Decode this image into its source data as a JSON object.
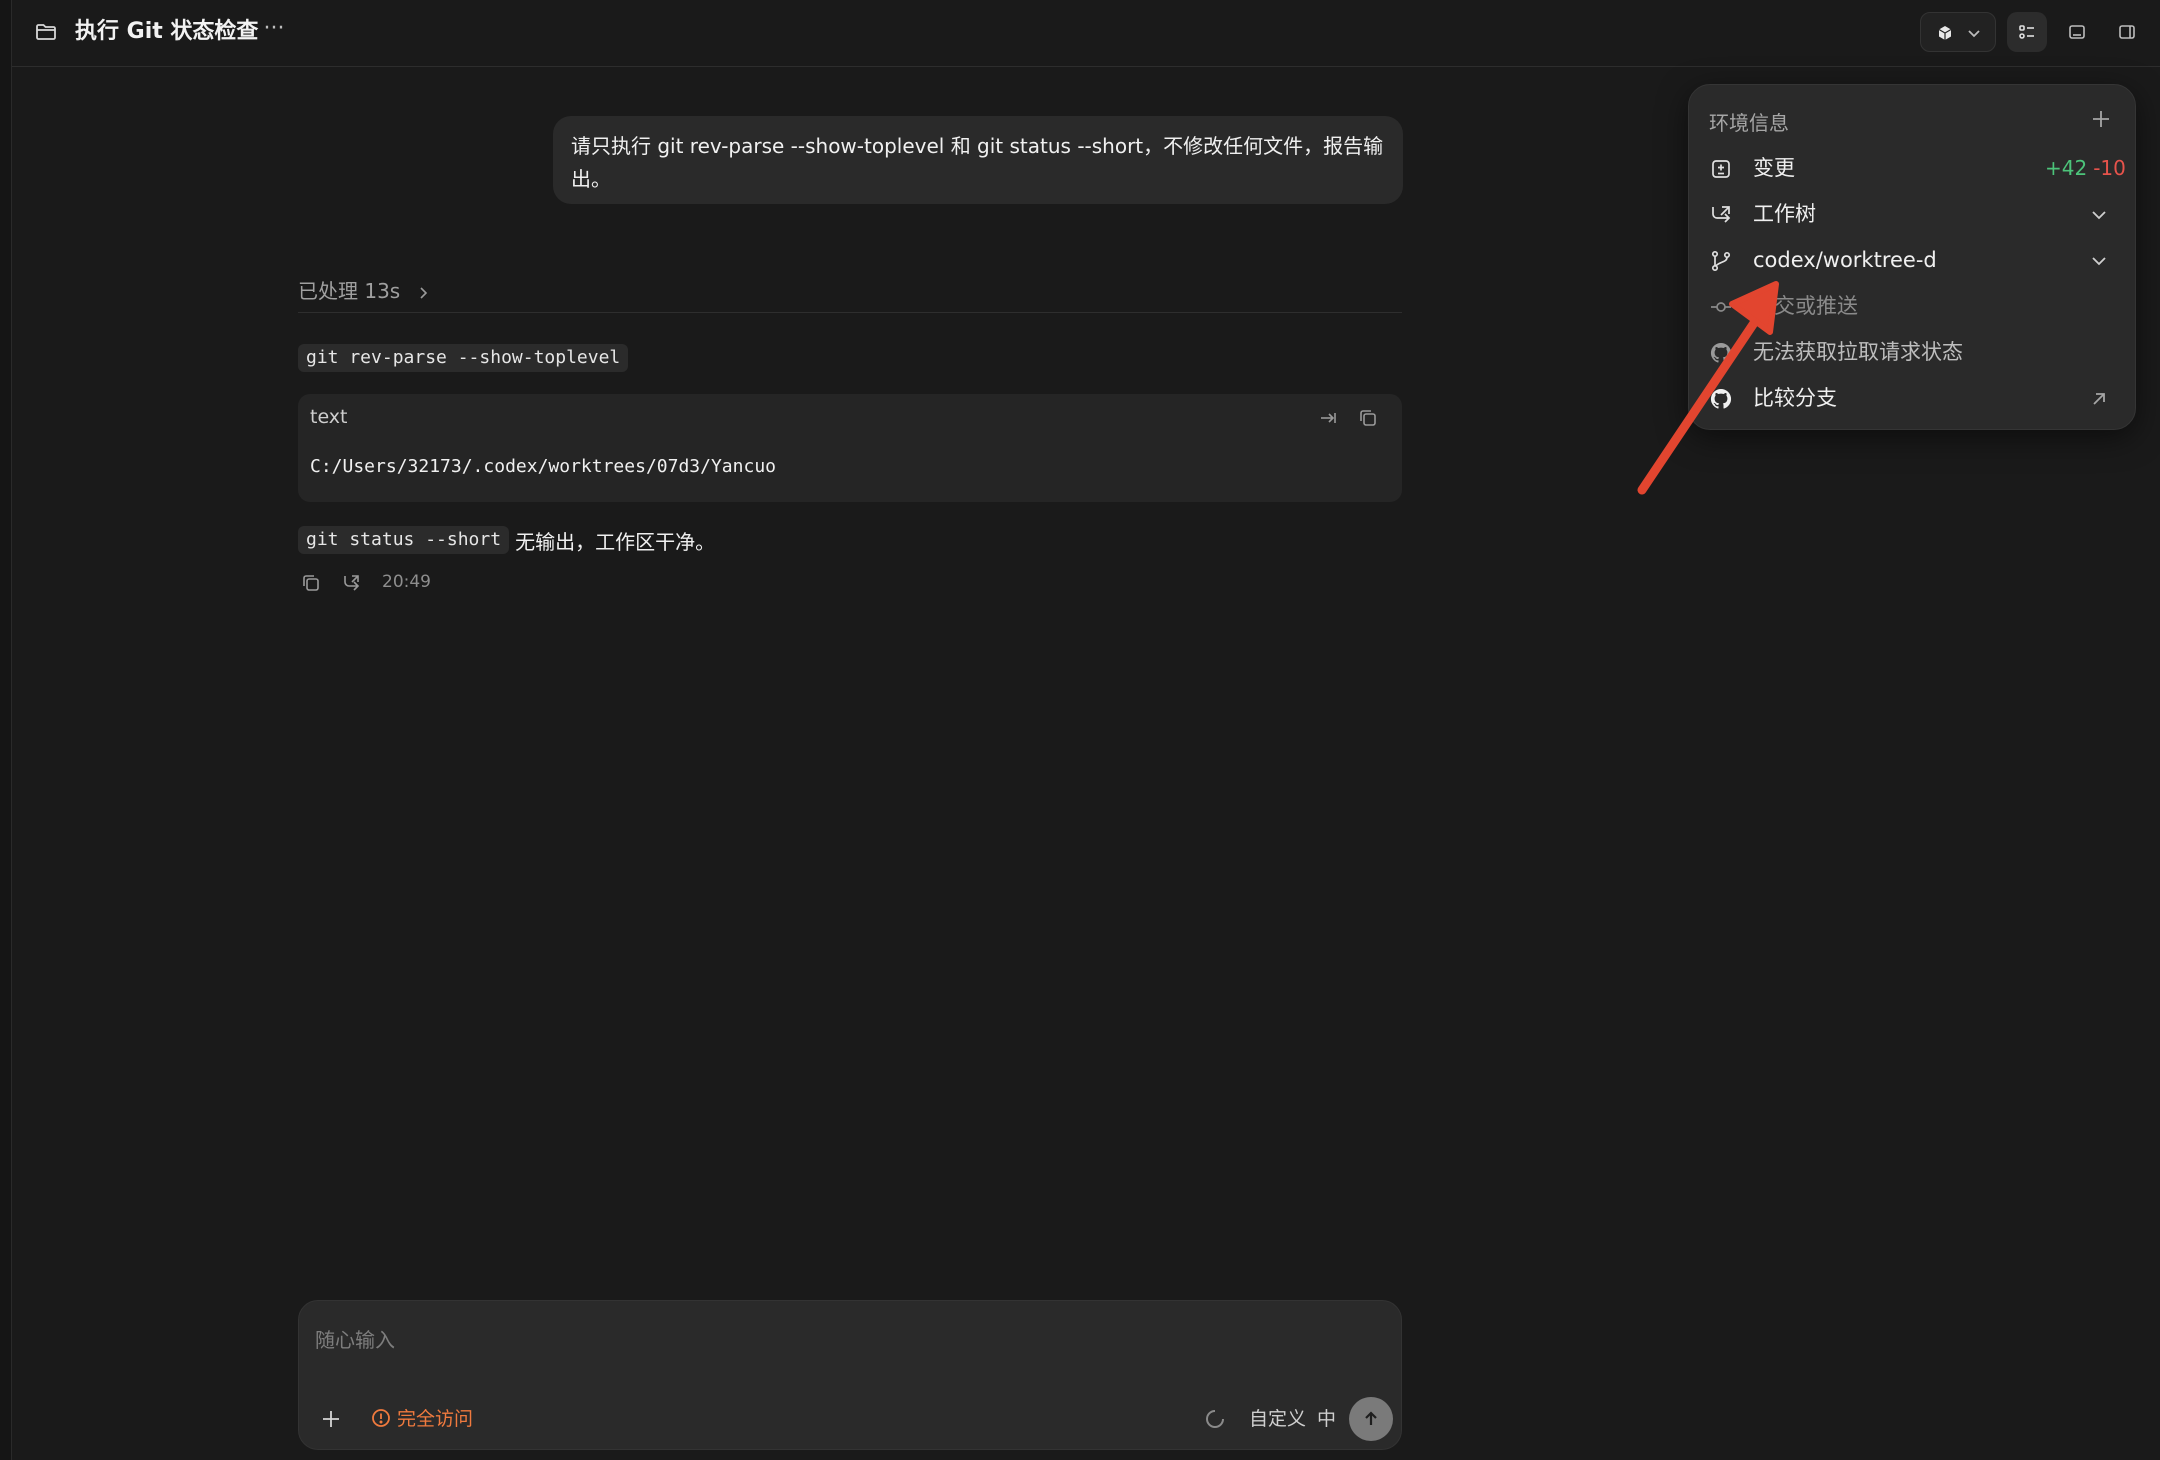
{
  "header": {
    "title": "执行 Git 状态检查",
    "more_label": "···"
  },
  "conversation": {
    "user_message": "请只执行 git rev-parse --show-toplevel 和 git status --short，不修改任何文件，报告输出。",
    "processed_label": "已处理 13s",
    "command_1": "git rev-parse --show-toplevel",
    "code_block": {
      "language": "text",
      "output": "C:/Users/32173/.codex/worktrees/07d3/Yancuo"
    },
    "command_2": "git status --short",
    "result_text": "无输出，工作区干净。",
    "time": "20:49"
  },
  "composer": {
    "placeholder": "随心输入",
    "access_label": "完全访问",
    "mode_label": "自定义",
    "lang_label": "中"
  },
  "env_panel": {
    "title": "环境信息",
    "changes_label": "变更",
    "additions": "+42",
    "deletions": "-10",
    "worktree_label": "工作树",
    "branch_label": "codex/worktree-d",
    "commit_push_label": "提交或推送",
    "pr_status_label": "无法获取拉取请求状态",
    "compare_label": "比较分支"
  },
  "colors": {
    "background": "#1a1a1a",
    "addition": "#4cc47a",
    "deletion": "#e6534b",
    "access_warning": "#f07a3e",
    "annotation_arrow": "#e2452f"
  }
}
